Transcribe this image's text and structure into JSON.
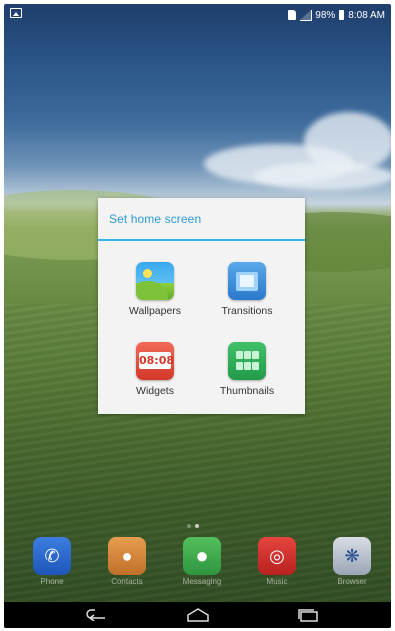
{
  "status_bar": {
    "battery_percent": "98%",
    "time": "8:08 AM",
    "icons": [
      "gallery-icon",
      "sim-icon",
      "signal-icon",
      "battery-icon"
    ]
  },
  "dialog": {
    "title": "Set home screen",
    "options": [
      {
        "label": "Wallpapers",
        "icon": "wallpapers-icon"
      },
      {
        "label": "Transitions",
        "icon": "transitions-icon"
      },
      {
        "label": "Widgets",
        "icon": "widgets-icon",
        "clock_text": "08:08"
      },
      {
        "label": "Thumbnails",
        "icon": "thumbnails-icon"
      }
    ]
  },
  "dock": [
    {
      "label": "Phone",
      "icon": "phone-icon"
    },
    {
      "label": "Contacts",
      "icon": "contacts-icon"
    },
    {
      "label": "Messaging",
      "icon": "messaging-icon"
    },
    {
      "label": "Music",
      "icon": "music-icon"
    },
    {
      "label": "Browser",
      "icon": "browser-icon"
    }
  ],
  "nav_bar": {
    "buttons": [
      "back-icon",
      "home-icon",
      "recents-icon"
    ]
  },
  "colors": {
    "accent": "#33b5e5",
    "dialog_bg": "#f3f3f3"
  }
}
